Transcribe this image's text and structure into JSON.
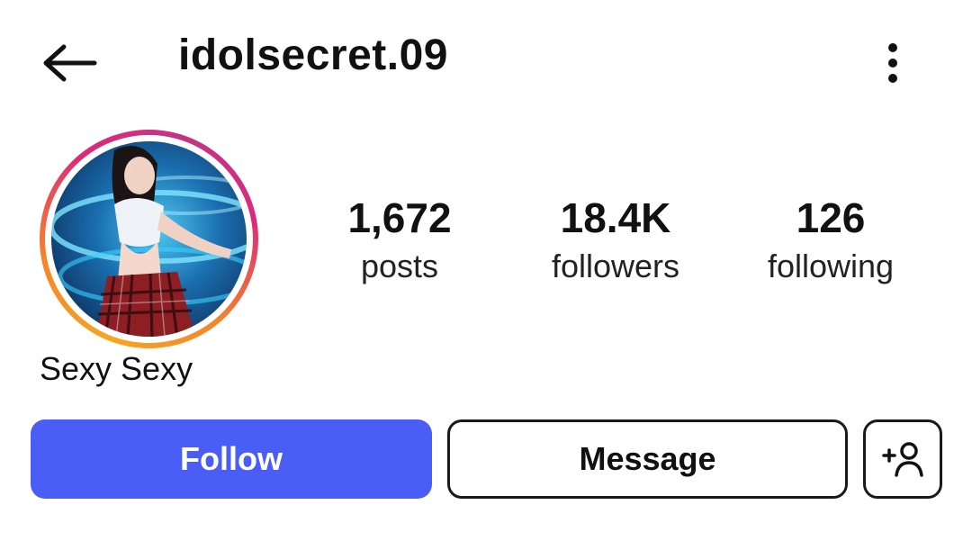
{
  "header": {
    "username": "idolsecret.09",
    "back_icon": "arrow-left-icon",
    "more_icon": "vertical-dots-icon"
  },
  "profile": {
    "display_name": "Sexy Sexy",
    "story_ring_colors": [
      "#f5a623",
      "#f58529",
      "#dd2a7b",
      "#c13584"
    ]
  },
  "stats": {
    "posts": {
      "value": "1,672",
      "label": "posts"
    },
    "followers": {
      "value": "18.4K",
      "label": "followers"
    },
    "following": {
      "value": "126",
      "label": "following"
    }
  },
  "actions": {
    "follow_label": "Follow",
    "message_label": "Message",
    "add_user_icon": "add-person-icon",
    "follow_color": "#4a5df5"
  }
}
